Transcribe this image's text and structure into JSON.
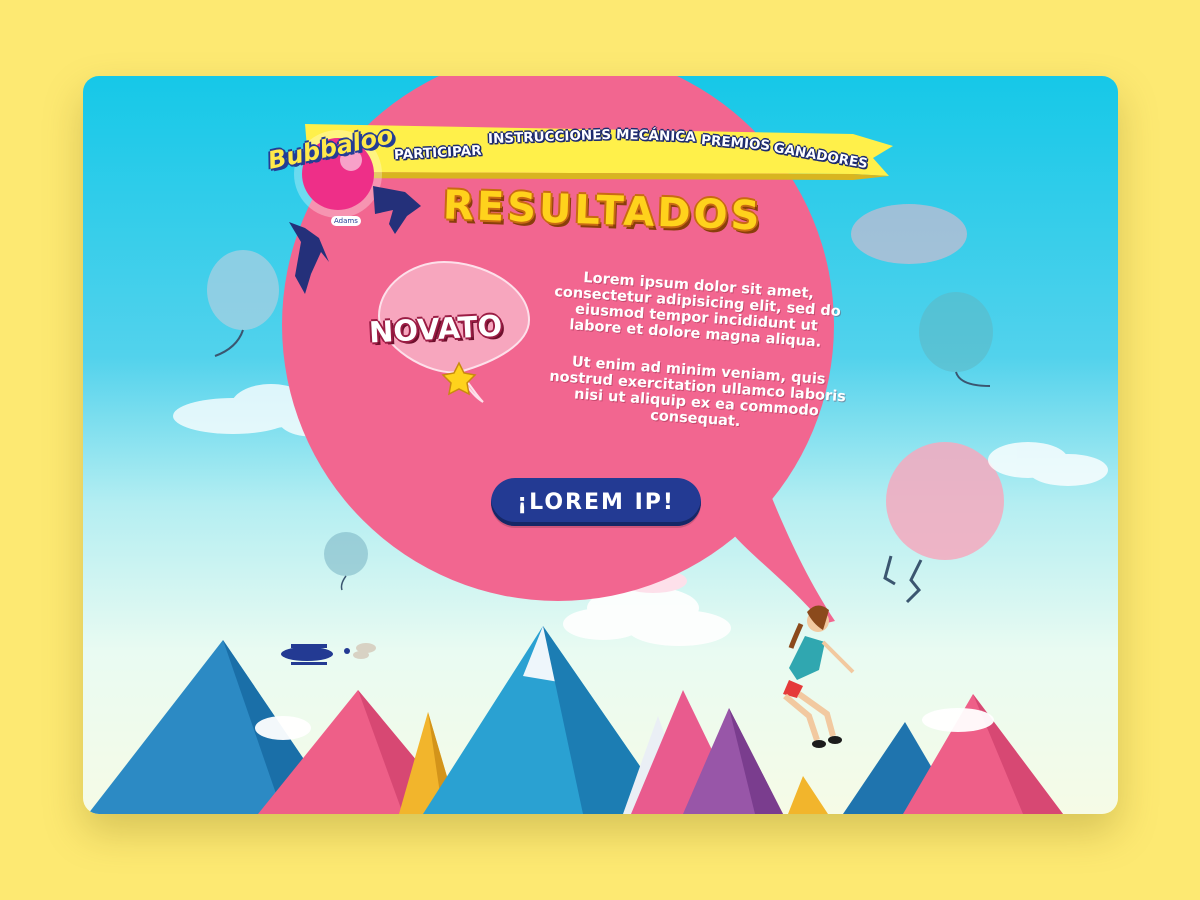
{
  "brand": {
    "logo_text": "Bubbaloo",
    "sub_logo": "Adams"
  },
  "nav": {
    "items": [
      {
        "label": "PARTICIPAR"
      },
      {
        "label": "INSTRUCCIONES"
      },
      {
        "label": "MECÁNICA"
      },
      {
        "label": "PREMIOS"
      },
      {
        "label": "GANADORES"
      }
    ]
  },
  "page": {
    "title": "RESULTADOS"
  },
  "badge": {
    "label": "NOVATO",
    "icon": "star-icon"
  },
  "content": {
    "paragraph_1": "Lorem ipsum dolor sit amet, consectetur adipisicing elit, sed do eiusmod tempor incididunt ut labore et dolore magna aliqua.",
    "paragraph_2": "Ut enim ad minim veniam, quis nostrud exercitation ullamco laboris nisi ut aliquip ex ea commodo consequat."
  },
  "cta": {
    "label": "¡LOREM IP!"
  },
  "colors": {
    "page_background": "#fde972",
    "sky": "#16c8e8",
    "balloon_pink": "#f26690",
    "ribbon_yellow": "#fff04a",
    "button_navy": "#233a93",
    "title_yellow": "#ffd21c"
  }
}
